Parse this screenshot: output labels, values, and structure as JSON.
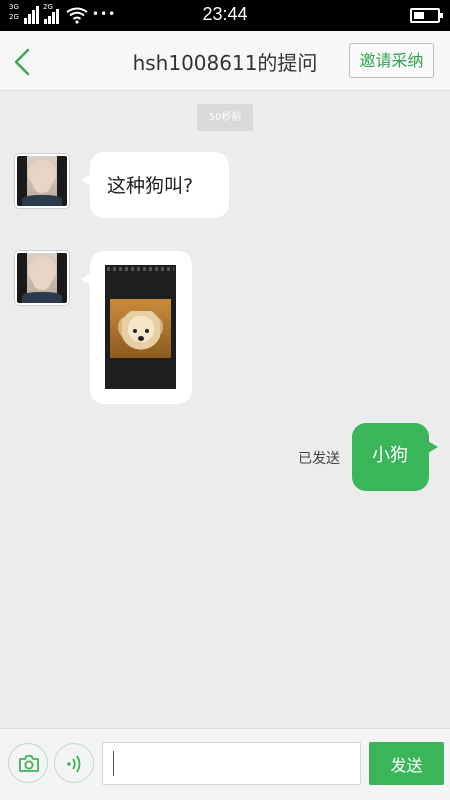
{
  "status_bar": {
    "network_1": "3G",
    "network_2": "2G",
    "network_3": "2G",
    "network_4": "2G",
    "time": "23:44",
    "more": "•••",
    "icons": [
      "signal-icon",
      "wifi-icon",
      "battery-icon"
    ]
  },
  "header": {
    "title": "hsh1008611的提问",
    "back_icon": "chevron-left-icon",
    "accept_invite_label": "邀请采纳",
    "accent": "#2fa44f"
  },
  "chat": {
    "time_chip": "50秒前",
    "messages": [
      {
        "from": "other",
        "type": "text",
        "text": "这种狗叫?"
      },
      {
        "from": "other",
        "type": "image",
        "image": "puppy-screenshot"
      },
      {
        "from": "me",
        "type": "text",
        "text": "小狗",
        "status": "已发送"
      }
    ],
    "bubble_out_color": "#3bb55a"
  },
  "input_bar": {
    "camera_icon": "camera-icon",
    "voice_icon": "voice-icon",
    "placeholder": "",
    "value": "",
    "send_label": "发送"
  }
}
